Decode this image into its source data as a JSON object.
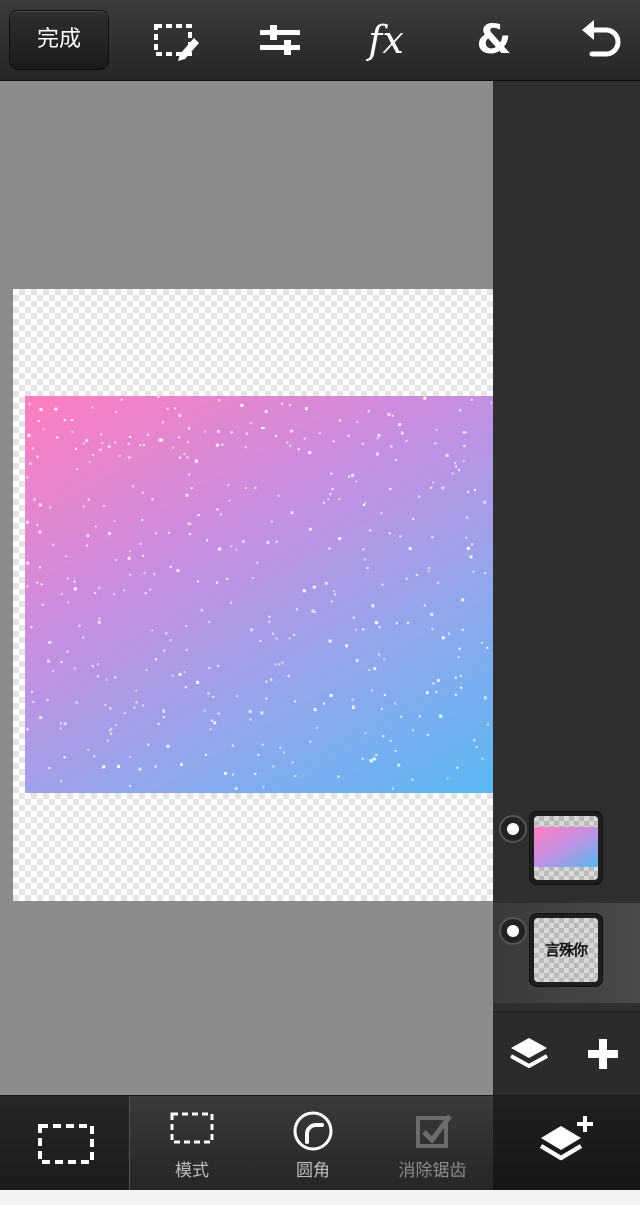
{
  "toolbar": {
    "done_label": "完成",
    "icons": [
      "selection-edit-icon",
      "adjustments-icon",
      "fx-icon",
      "blend-icon",
      "undo-icon"
    ],
    "fx_label": "fx",
    "blend_label": "&"
  },
  "layers": {
    "items": [
      {
        "name": "gradient-layer",
        "selected": false
      },
      {
        "name": "text-layer",
        "thumb_text": "言殊你",
        "selected": true
      }
    ]
  },
  "bottom_toolbar": {
    "items": [
      {
        "label": "",
        "icon": "rect-select-icon",
        "active": true
      },
      {
        "label": "模式",
        "icon": "mode-icon"
      },
      {
        "label": "圆角",
        "icon": "round-corner-icon"
      },
      {
        "label": "消除锯齿",
        "icon": "antialias-icon",
        "disabled": true
      }
    ]
  },
  "colors": {
    "gradient_start": "#ff7ec0",
    "gradient_end": "#5ab8f2",
    "workspace": "#8c8c8c",
    "panel": "#2f2f2f"
  }
}
